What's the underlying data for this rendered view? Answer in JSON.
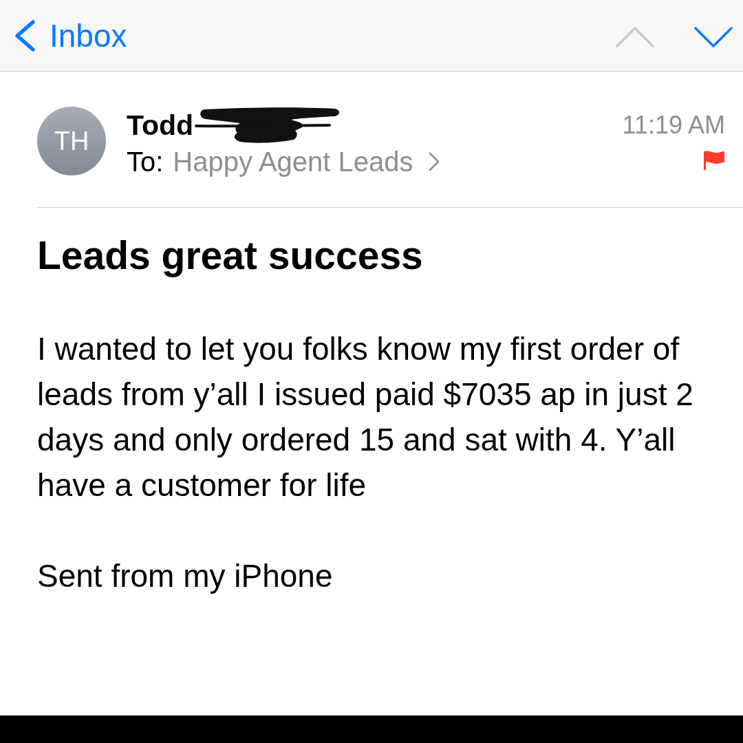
{
  "nav_bar": {
    "back_label": "Inbox",
    "previous_disabled": true,
    "next_disabled": false
  },
  "message": {
    "sender": {
      "initials": "TH",
      "name": "Todd",
      "redacted": true
    },
    "to_label": "To:",
    "recipient": "Happy Agent Leads",
    "time": "11:19 AM",
    "flagged": true,
    "subject": "Leads great success",
    "body": [
      "I wanted to let you folks know my first order of leads from y’all I issued paid $7035 ap in just 2 days and only ordered 15 and sat with 4. Y’all have a customer for life",
      "Sent from my iPhone"
    ]
  }
}
